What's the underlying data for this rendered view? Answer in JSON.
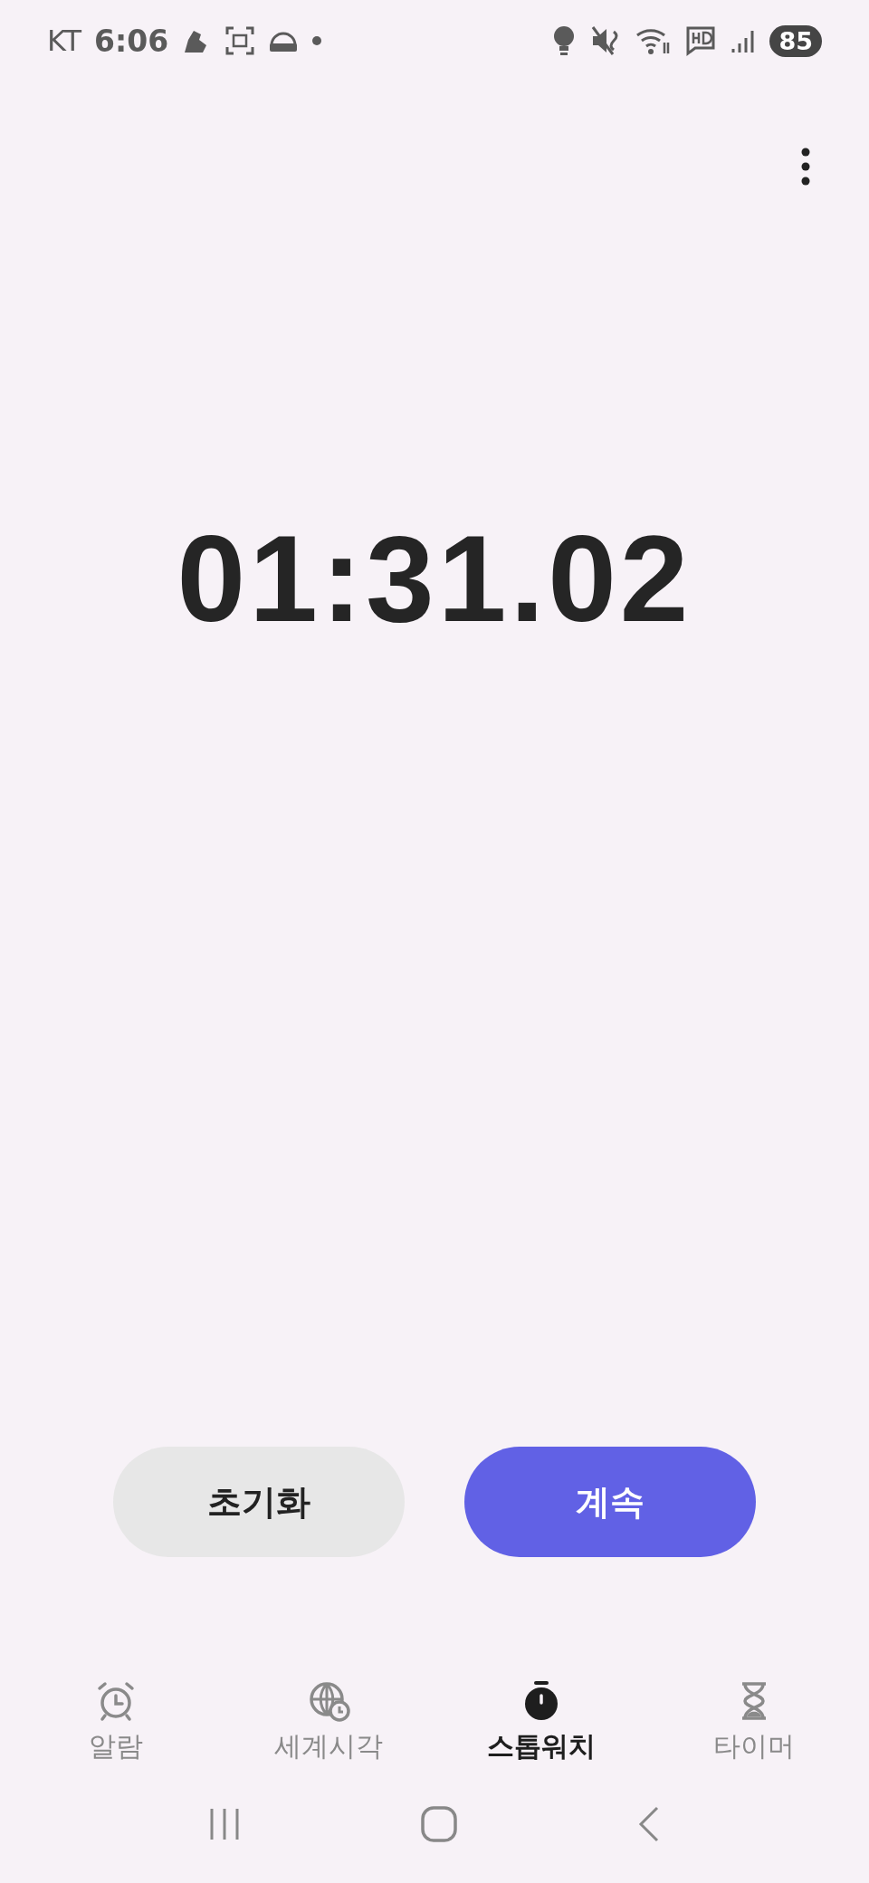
{
  "status_bar": {
    "carrier": "KT",
    "time": "6:06",
    "battery": "85"
  },
  "stopwatch": {
    "time": "01:31.02"
  },
  "buttons": [
    {
      "label": "초기화",
      "kind": "secondary"
    },
    {
      "label": "계속",
      "kind": "primary"
    }
  ],
  "tabs": [
    {
      "label": "알람",
      "kind": "alarm",
      "selected": false
    },
    {
      "label": "세계시각",
      "kind": "world",
      "selected": false
    },
    {
      "label": "스톱워치",
      "kind": "stopwatch",
      "selected": true
    },
    {
      "label": "타이머",
      "kind": "timer",
      "selected": false
    }
  ]
}
